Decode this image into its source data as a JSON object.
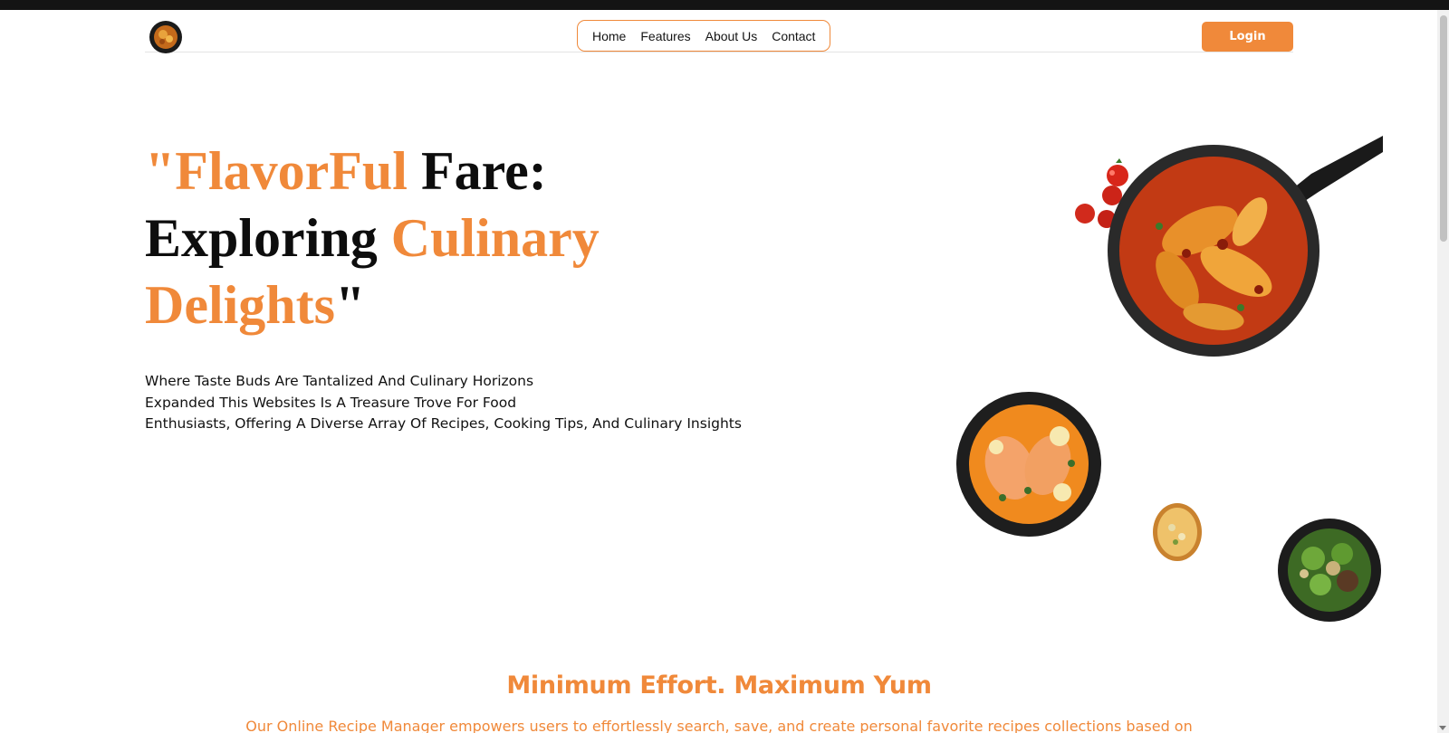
{
  "nav": {
    "links": [
      "Home",
      "Features",
      "About Us",
      "Contact"
    ],
    "login_label": "Login"
  },
  "hero": {
    "title_parts": [
      "\"FlavorFul",
      "Fare:",
      "Exploring",
      "Culinary",
      "Delights",
      "\""
    ],
    "description_lines": [
      "Where Taste Buds Are Tantalized And Culinary Horizons",
      "Expanded This Websites Is A Treasure Trove For Food",
      "Enthusiasts, Offering A Diverse Array Of Recipes, Cooking Tips, And Culinary Insights"
    ]
  },
  "section": {
    "title": "Minimum Effort. Maximum Yum",
    "description": "Our Online Recipe Manager empowers users to effortlessly search, save, and create personal favorite recipes collections based on"
  },
  "theme": {
    "accent": "#f0893a",
    "dark": "#141414"
  }
}
